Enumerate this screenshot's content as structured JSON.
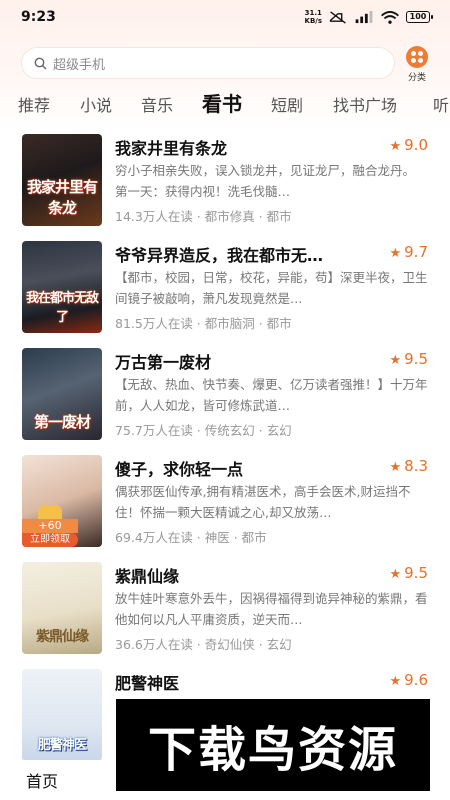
{
  "status_bar": {
    "time": "9:23",
    "net_speed_value": "31.1",
    "net_speed_unit": "KB/s",
    "battery": "100"
  },
  "search": {
    "placeholder": "超级手机"
  },
  "category_button": {
    "label": "分类"
  },
  "tabs": [
    {
      "label": "推荐"
    },
    {
      "label": "小说"
    },
    {
      "label": "音乐"
    },
    {
      "label": "看书",
      "active": true
    },
    {
      "label": "短剧"
    },
    {
      "label": "找书广场"
    },
    {
      "label": "听"
    }
  ],
  "books": [
    {
      "title": "我家井里有条龙",
      "cover_text": "我家井里有条龙",
      "rating": "9.0",
      "desc": "穷小子相亲失败，误入锁龙井，见证龙尸，融合龙丹。　　第一天：获得内视！洗毛伐髓…",
      "meta": "14.3万人在读 · 都市修真 · 都市"
    },
    {
      "title": "爷爷异界造反，我在都市无…",
      "cover_text": "我在都市无敌了",
      "rating": "9.7",
      "desc": "【都市，校园，日常，校花，异能，苟】深更半夜，卫生间镜子被敲响，萧凡发现竟然是…",
      "meta": "81.5万人在读 · 都市脑洞 · 都市"
    },
    {
      "title": "万古第一废材",
      "cover_text": "第一废材",
      "rating": "9.5",
      "desc": "【无敌、热血、快节奏、爆更、亿万读者强推！】十万年前，人人如龙，皆可修炼武道…",
      "meta": "75.7万人在读 · 传统玄幻 · 玄幻"
    },
    {
      "title": "傻子，求你轻一点",
      "cover_text": "",
      "rating": "8.3",
      "desc": "偶获邪医仙传承,拥有精湛医术，高手会医术,财运挡不住！怀揣一颗大医精诚之心,却又放荡…",
      "meta": "69.4万人在读 · 神医 · 都市",
      "badge": {
        "amount": "+60",
        "label": "立即领取"
      }
    },
    {
      "title": "紫鼎仙缘",
      "cover_text": "紫鼎仙缘",
      "rating": "9.5",
      "desc": "放牛娃叶寒意外丢牛，因祸得福得到诡异神秘的紫鼎，看他如何以凡人平庸资质，逆天而…",
      "meta": "36.6万人在读 · 奇幻仙侠 · 玄幻"
    },
    {
      "title": "肥警神医",
      "cover_text": "肥警神医",
      "rating": "9.6",
      "desc": "",
      "meta": ""
    }
  ],
  "watermark": {
    "text": "下载鸟资源"
  },
  "bottom_nav": {
    "home": "首页"
  },
  "colors": {
    "accent": "#e8702a",
    "category_icon": "#f07b33"
  }
}
